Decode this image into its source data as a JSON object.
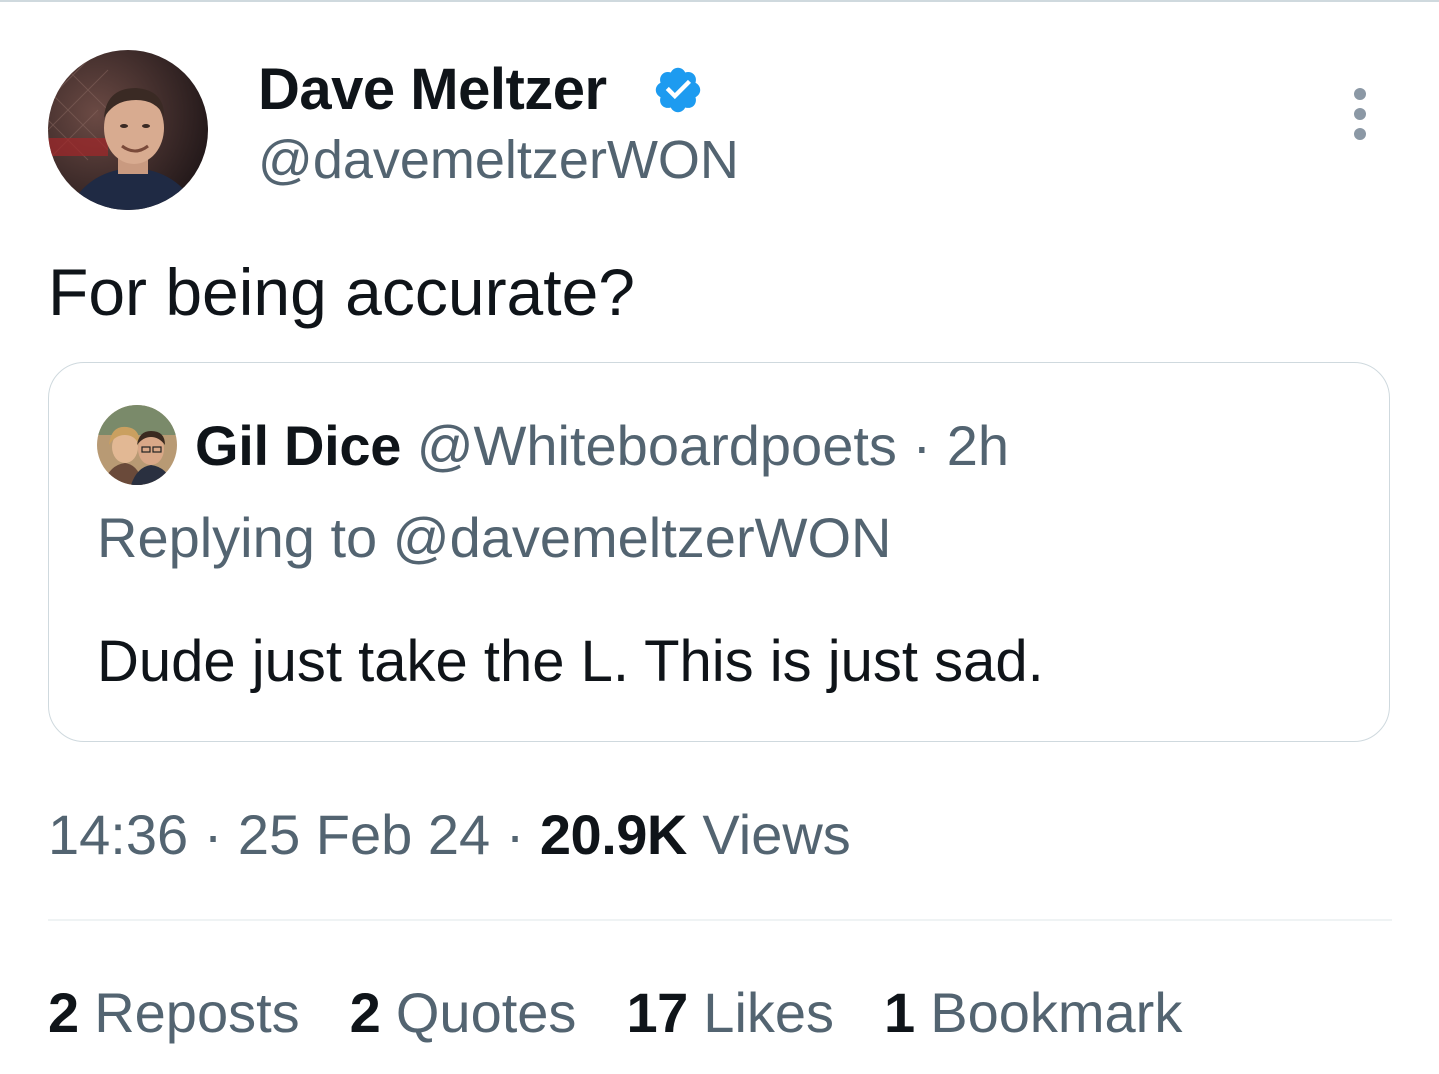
{
  "author": {
    "name": "Dave Meltzer",
    "handle": "@davemeltzerWON",
    "verified": true
  },
  "tweet": {
    "text": "For being accurate?"
  },
  "quoted": {
    "name": "Gil Dice",
    "handle": "@Whiteboardpoets",
    "separator": "·",
    "time": "2h",
    "replying_to": "Replying to @davemeltzerWON",
    "text": "Dude just take the L. This is just sad."
  },
  "meta": {
    "time": "14:36",
    "sep1": "·",
    "date": "25 Feb 24",
    "sep2": "·",
    "views_count": "20.9K",
    "views_label": "Views"
  },
  "stats": {
    "reposts_count": "2",
    "reposts_label": "Reposts",
    "quotes_count": "2",
    "quotes_label": "Quotes",
    "likes_count": "17",
    "likes_label": "Likes",
    "bookmarks_count": "1",
    "bookmarks_label": "Bookmark"
  },
  "icons": {
    "verified": "verified-badge-icon",
    "more": "more-options-icon"
  },
  "colors": {
    "text_primary": "#0f1419",
    "text_secondary": "#536471",
    "verified_blue": "#1d9bf0",
    "border": "#cfd9de"
  }
}
